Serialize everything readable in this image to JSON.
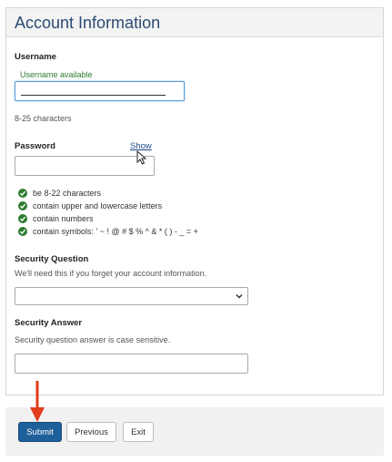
{
  "section": {
    "title": "Account Information"
  },
  "username": {
    "label": "Username",
    "status": "Username available",
    "hint": "8-25 characters"
  },
  "password": {
    "label": "Password",
    "show_link": "Show",
    "rules": [
      "be 8-22 characters",
      "contain upper and lowercase letters",
      "contain numbers",
      "contain symbols: ' ~ ! @ # $ % ^ & * ( ) - _ = +"
    ]
  },
  "security_question": {
    "label": "Security Question",
    "hint": "We'll need this if you forget your account information.",
    "selected": ""
  },
  "security_answer": {
    "label": "Security Answer",
    "hint": "Security question answer is case sensitive."
  },
  "buttons": {
    "submit": "Submit",
    "previous": "Previous",
    "exit": "Exit"
  },
  "colors": {
    "header_text": "#2b4a73",
    "success": "#2e7d32",
    "primary_button": "#1f5f9a",
    "annotation_arrow": "#e23b1e"
  }
}
